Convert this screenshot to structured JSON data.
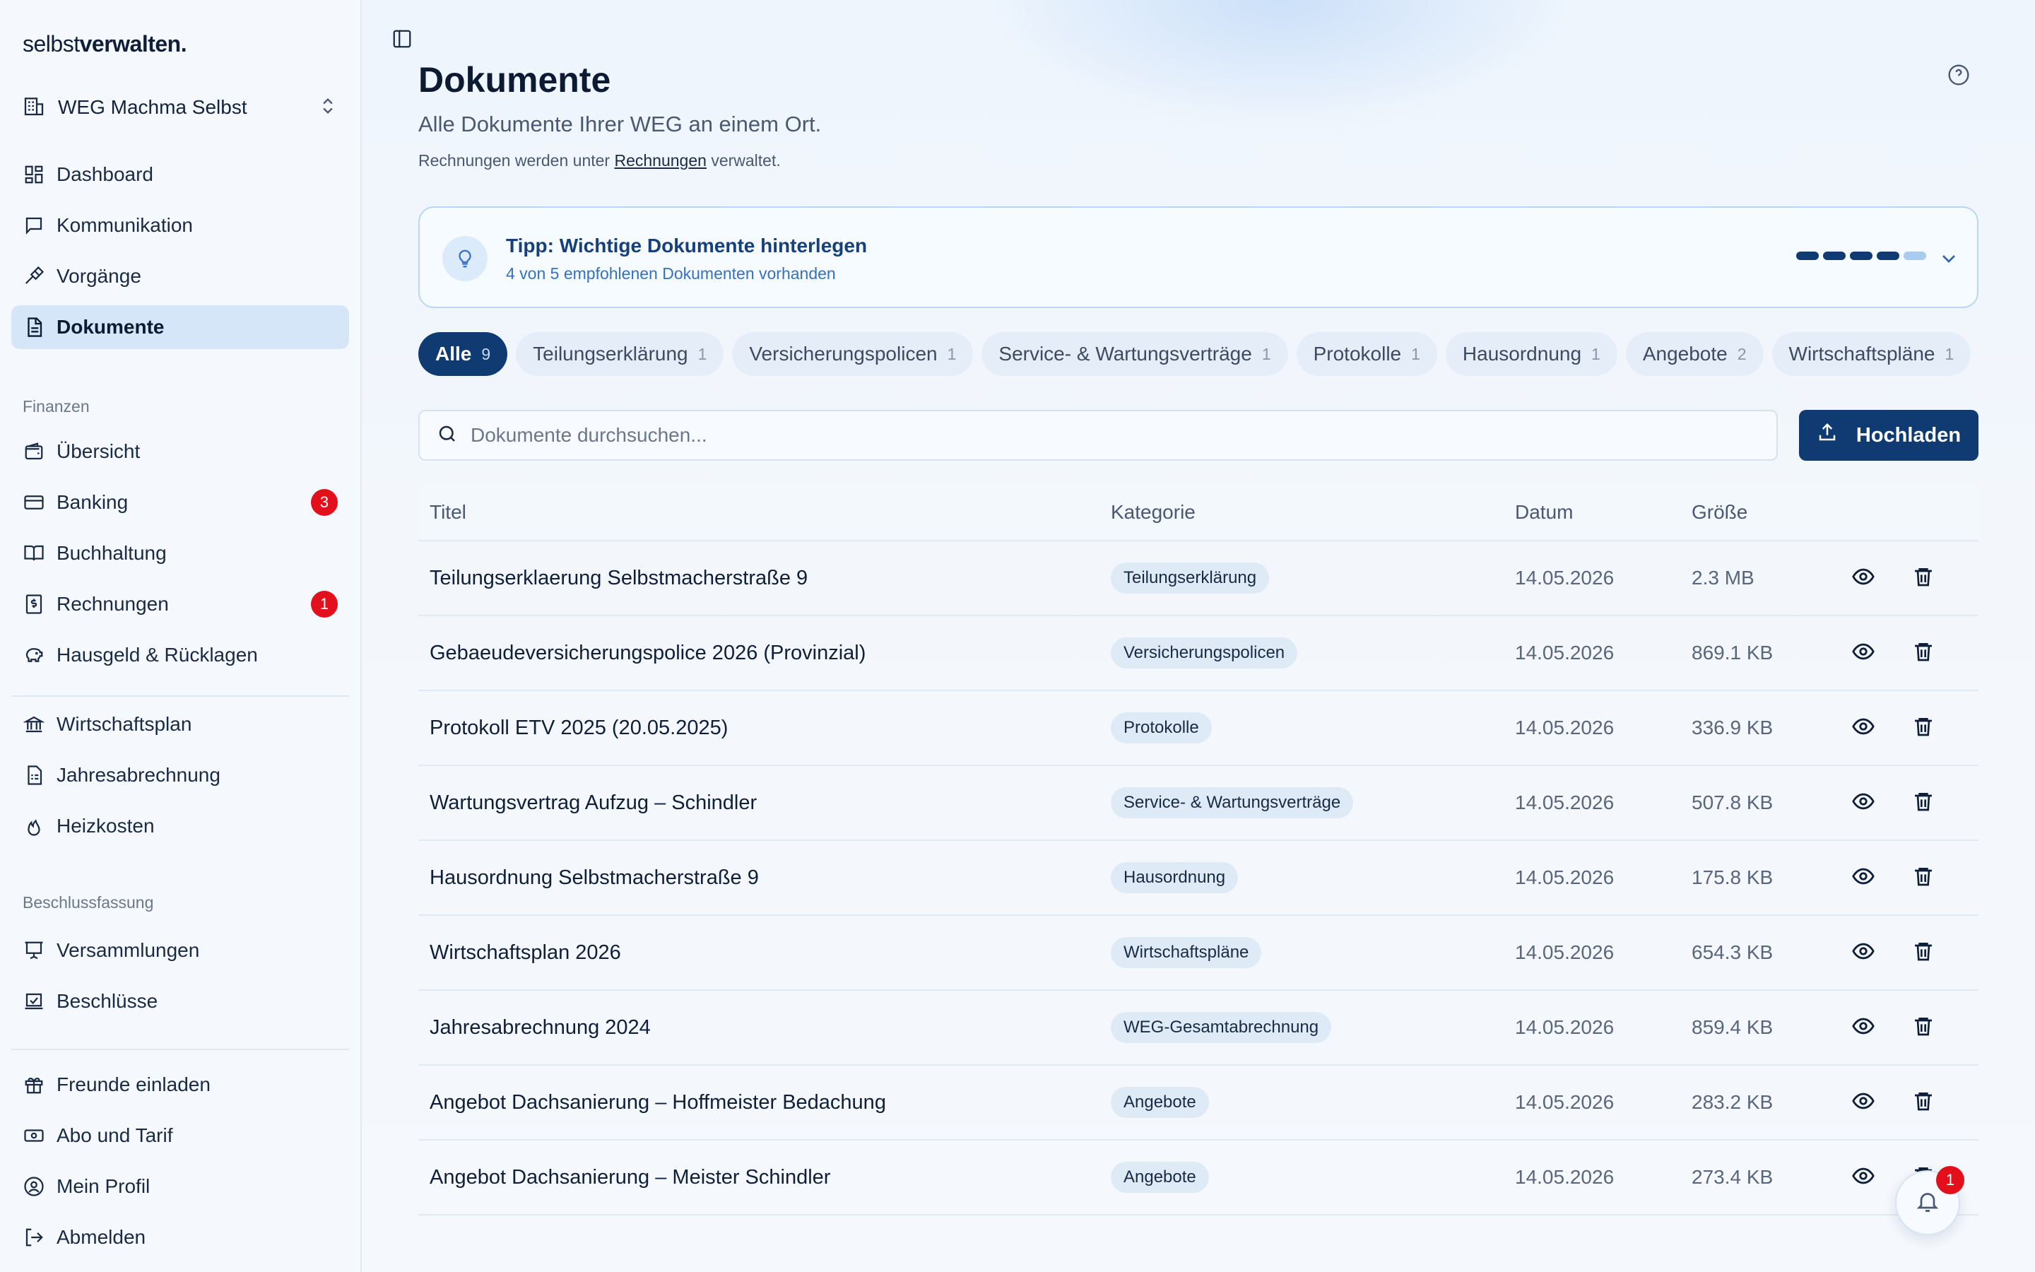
{
  "app": {
    "logo_light": "selbst",
    "logo_bold": "verwalten."
  },
  "sidebar": {
    "workspace": "WEG Machma Selbst",
    "main_items": [
      {
        "label": "Dashboard",
        "icon": "dashboard-icon"
      },
      {
        "label": "Kommunikation",
        "icon": "message-icon"
      },
      {
        "label": "Vorgänge",
        "icon": "hammer-icon"
      },
      {
        "label": "Dokumente",
        "icon": "document-icon",
        "active": true
      }
    ],
    "finanzen_title": "Finanzen",
    "finanzen_items": [
      {
        "label": "Übersicht",
        "icon": "wallet-icon"
      },
      {
        "label": "Banking",
        "icon": "card-icon",
        "badge": "3"
      },
      {
        "label": "Buchhaltung",
        "icon": "book-icon"
      },
      {
        "label": "Rechnungen",
        "icon": "invoice-icon",
        "badge": "1"
      },
      {
        "label": "Hausgeld & Rücklagen",
        "icon": "piggybank-icon"
      }
    ],
    "plan_items": [
      {
        "label": "Wirtschaftsplan",
        "icon": "bank-icon"
      },
      {
        "label": "Jahresabrechnung",
        "icon": "sheet-icon"
      },
      {
        "label": "Heizkosten",
        "icon": "flame-icon"
      }
    ],
    "beschluss_title": "Beschlussfassung",
    "beschluss_items": [
      {
        "label": "Versammlungen",
        "icon": "presentation-icon"
      },
      {
        "label": "Beschlüsse",
        "icon": "ballot-icon"
      }
    ],
    "account_items": [
      {
        "label": "Freunde einladen",
        "icon": "gift-icon"
      },
      {
        "label": "Abo und Tarif",
        "icon": "ticket-icon"
      },
      {
        "label": "Mein Profil",
        "icon": "user-circle-icon"
      },
      {
        "label": "Abmelden",
        "icon": "logout-icon"
      }
    ]
  },
  "header": {
    "title": "Dokumente",
    "subtitle": "Alle Dokumente Ihrer WEG an einem Ort.",
    "note_prefix": "Rechnungen werden unter ",
    "note_link": "Rechnungen",
    "note_suffix": " verwaltet."
  },
  "tip": {
    "title": "Tipp: Wichtige Dokumente hinterlegen",
    "text": "4 von 5 empfohlenen Dokumenten vorhanden",
    "progress_done": 4,
    "progress_total": 5
  },
  "filters": [
    {
      "label": "Alle",
      "count": "9",
      "active": true
    },
    {
      "label": "Teilungserklärung",
      "count": "1"
    },
    {
      "label": "Versicherungspolicen",
      "count": "1"
    },
    {
      "label": "Service- & Wartungsverträge",
      "count": "1"
    },
    {
      "label": "Protokolle",
      "count": "1"
    },
    {
      "label": "Hausordnung",
      "count": "1"
    },
    {
      "label": "Angebote",
      "count": "2"
    },
    {
      "label": "Wirtschaftspläne",
      "count": "1"
    }
  ],
  "search": {
    "placeholder": "Dokumente durchsuchen..."
  },
  "upload_label": "Hochladen",
  "table": {
    "headers": [
      "Titel",
      "Kategorie",
      "Datum",
      "Größe"
    ],
    "rows": [
      {
        "title": "Teilungserklaerung Selbstmacherstraße 9",
        "category": "Teilungserklärung",
        "date": "14.05.2026",
        "size": "2.3 MB"
      },
      {
        "title": "Gebaeudeversicherungspolice 2026 (Provinzial)",
        "category": "Versicherungspolicen",
        "date": "14.05.2026",
        "size": "869.1 KB"
      },
      {
        "title": "Protokoll ETV 2025 (20.05.2025)",
        "category": "Protokolle",
        "date": "14.05.2026",
        "size": "336.9 KB"
      },
      {
        "title": "Wartungsvertrag Aufzug – Schindler",
        "category": "Service- & Wartungsverträge",
        "date": "14.05.2026",
        "size": "507.8 KB"
      },
      {
        "title": "Hausordnung Selbstmacherstraße 9",
        "category": "Hausordnung",
        "date": "14.05.2026",
        "size": "175.8 KB"
      },
      {
        "title": "Wirtschaftsplan 2026",
        "category": "Wirtschaftspläne",
        "date": "14.05.2026",
        "size": "654.3 KB"
      },
      {
        "title": "Jahresabrechnung 2024",
        "category": "WEG-Gesamtabrechnung",
        "date": "14.05.2026",
        "size": "859.4 KB"
      },
      {
        "title": "Angebot Dachsanierung – Hoffmeister Bedachung",
        "category": "Angebote",
        "date": "14.05.2026",
        "size": "283.2 KB"
      },
      {
        "title": "Angebot Dachsanierung – Meister Schindler",
        "category": "Angebote",
        "date": "14.05.2026",
        "size": "273.4 KB"
      }
    ]
  },
  "notifications": {
    "count": "1"
  },
  "colors": {
    "accent": "#0f3b72",
    "active_nav": "#d6e6f9",
    "badge": "#e3101c"
  }
}
